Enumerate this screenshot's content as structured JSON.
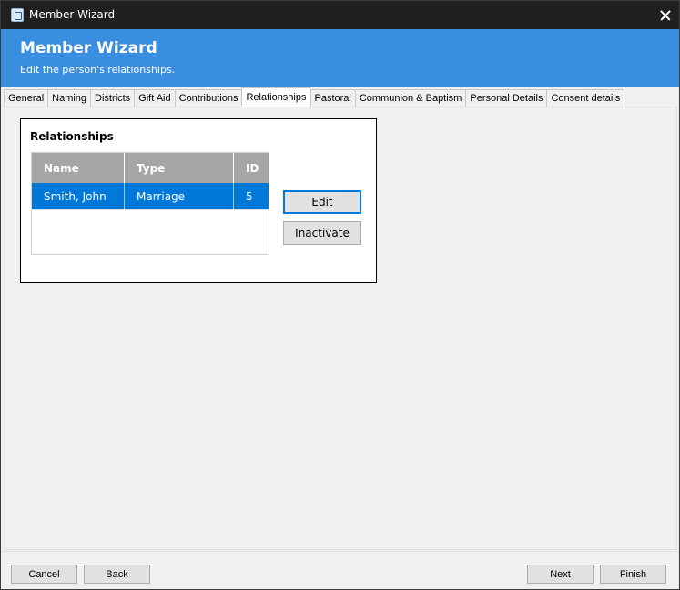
{
  "window": {
    "title": "Member Wizard"
  },
  "header": {
    "title": "Member Wizard",
    "subtitle": "Edit the person's relationships."
  },
  "tabs": [
    {
      "label": "General",
      "active": false
    },
    {
      "label": "Naming",
      "active": false
    },
    {
      "label": "Districts",
      "active": false
    },
    {
      "label": "Gift Aid",
      "active": false
    },
    {
      "label": "Contributions",
      "active": false
    },
    {
      "label": "Relationships",
      "active": true
    },
    {
      "label": "Pastoral",
      "active": false
    },
    {
      "label": "Communion & Baptism",
      "active": false
    },
    {
      "label": "Personal Details",
      "active": false
    },
    {
      "label": "Consent details",
      "active": false
    }
  ],
  "relationships": {
    "group_title": "Relationships",
    "columns": [
      "Name",
      "Type",
      "ID"
    ],
    "rows": [
      {
        "name": "Smith, John",
        "type": "Marriage",
        "id": "5",
        "selected": true
      }
    ],
    "edit_label": "Edit",
    "inactivate_label": "Inactivate"
  },
  "footer": {
    "cancel_label": "Cancel",
    "back_label": "Back",
    "next_label": "Next",
    "finish_label": "Finish"
  },
  "colors": {
    "header_bg": "#3a8ee0",
    "selection": "#0078d7",
    "titlebar_bg": "#202020"
  }
}
